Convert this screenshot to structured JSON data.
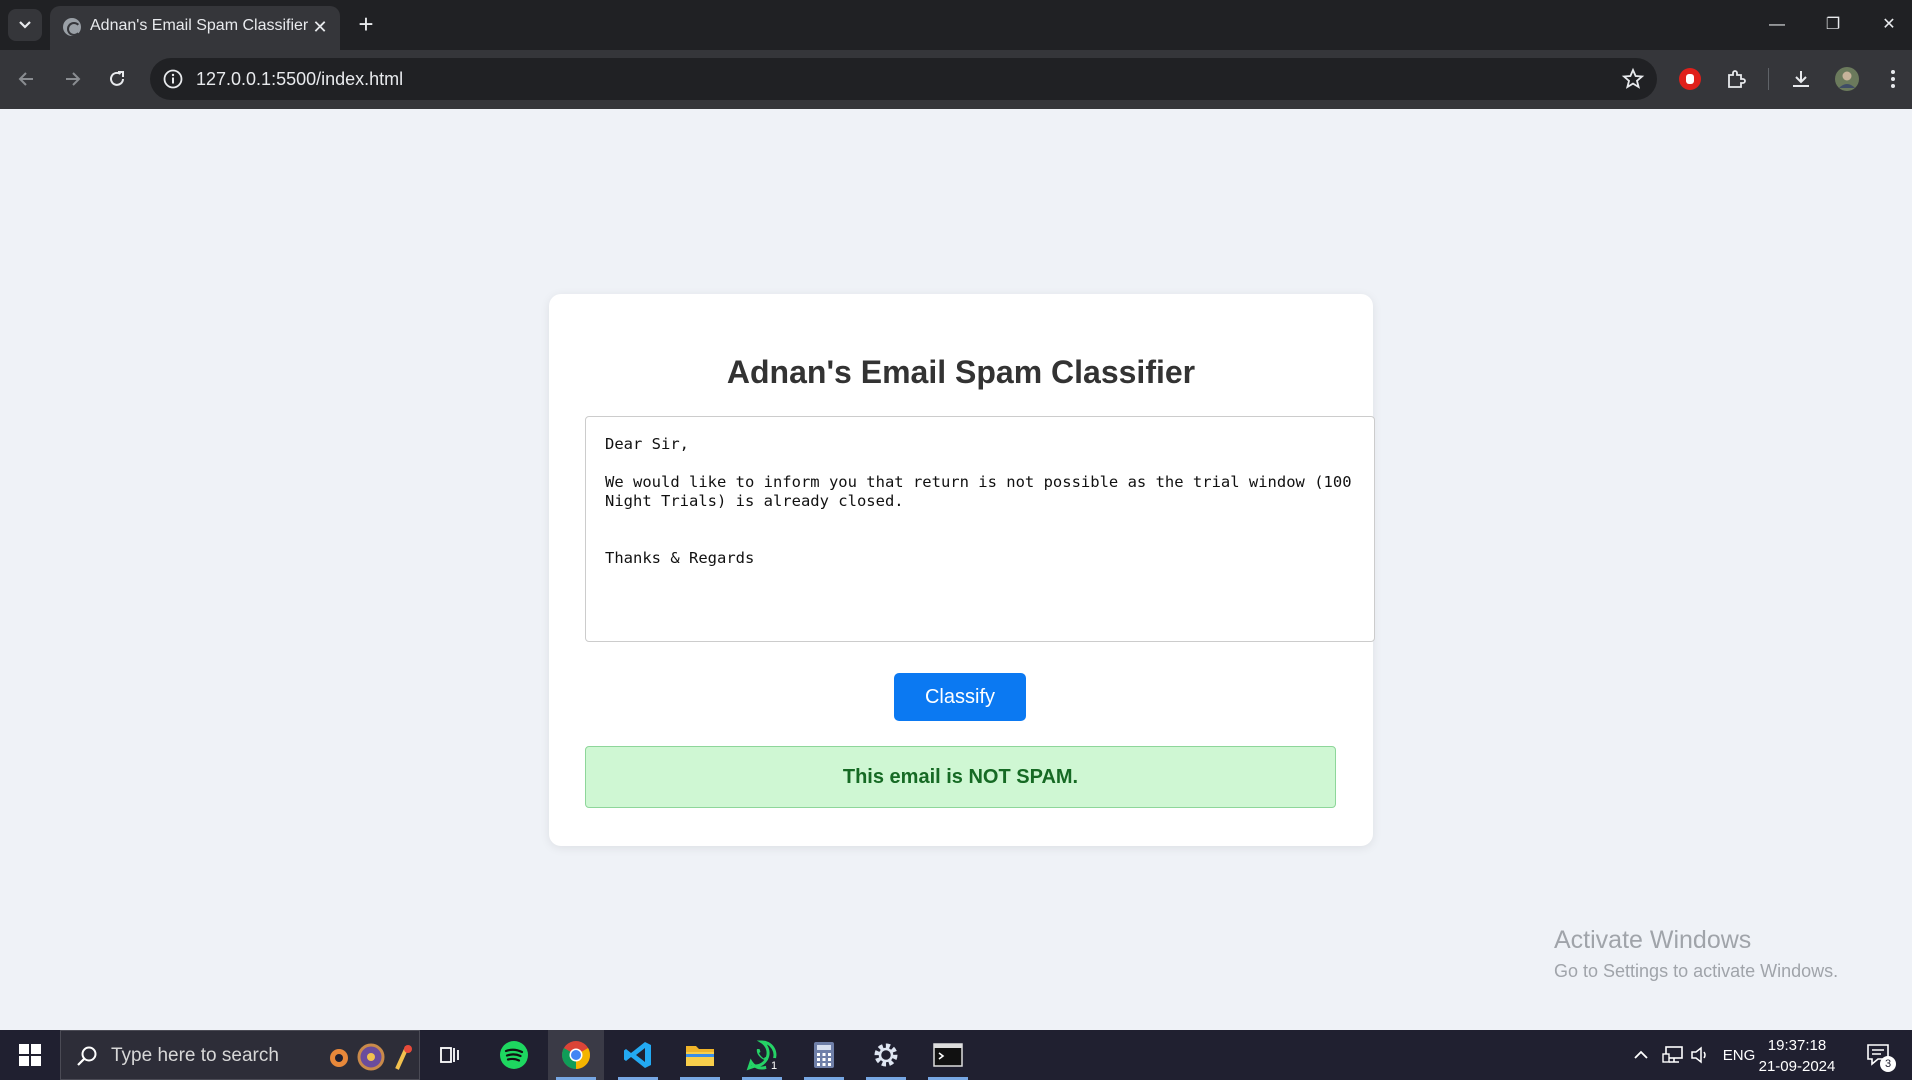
{
  "browser": {
    "tab_title": "Adnan's Email Spam Classifier",
    "tab_close": "✕",
    "new_tab": "+",
    "url": "127.0.0.1:5500/index.html"
  },
  "window_controls": {
    "minimize": "—",
    "restore": "❐",
    "close": "✕"
  },
  "page": {
    "title": "Adnan's Email Spam Classifier",
    "email_text": "Dear Sir,\n\nWe would like to inform you that return is not possible as the trial window (100 Night Trials) is already closed.\n\n\nThanks & Regards",
    "classify_button": "Classify",
    "result": "This email is NOT SPAM."
  },
  "watermark": {
    "title": "Activate Windows",
    "subtitle": "Go to Settings to activate Windows."
  },
  "taskbar": {
    "search_placeholder": "Type here to search",
    "apps": [
      "task-view",
      "spotify",
      "chrome",
      "vscode",
      "file-explorer",
      "whatsapp",
      "calculator",
      "settings",
      "terminal"
    ],
    "whatsapp_badge": "1",
    "language": "ENG",
    "time": "19:37:18",
    "date": "21-09-2024",
    "notification_count": "3"
  },
  "colors": {
    "page_bg": "#eff2f7",
    "button": "#0b79f2",
    "result_bg": "#cff7d3",
    "result_text": "#166a24"
  }
}
